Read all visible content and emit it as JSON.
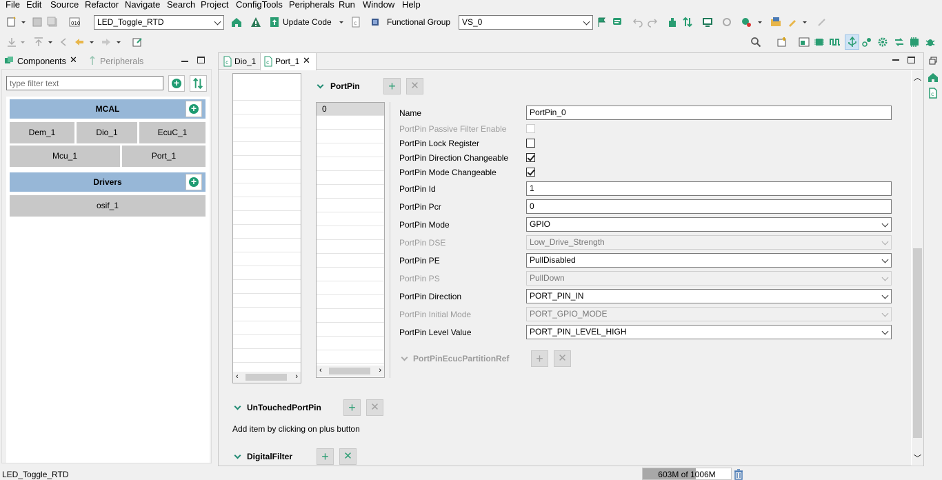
{
  "menu": [
    "File",
    "Edit",
    "Source",
    "Refactor",
    "Navigate",
    "Search",
    "Project",
    "ConfigTools",
    "Peripherals",
    "Run",
    "Window",
    "Help"
  ],
  "toolbar": {
    "project_combo": "LED_Toggle_RTD",
    "update_code_label": "Update Code",
    "functional_group_label": "Functional Group",
    "functional_group_value": "VS_0"
  },
  "left_panel": {
    "tabs": [
      {
        "label": "Components"
      },
      {
        "label": "Peripherals"
      }
    ],
    "filter_placeholder": "type filter text",
    "groups": [
      {
        "title": "MCAL",
        "items": [
          "Dem_1",
          "Dio_1",
          "EcuC_1",
          "Mcu_1",
          "Port_1"
        ]
      },
      {
        "title": "Drivers",
        "items": [
          "osif_1"
        ]
      }
    ]
  },
  "editor": {
    "tabs": [
      {
        "label": "Dio_1"
      },
      {
        "label": "Port_1"
      }
    ],
    "portpin_section": "PortPin",
    "portpin_list": [
      "0"
    ],
    "properties": [
      {
        "label": "Name",
        "type": "text",
        "value": "PortPin_0",
        "enabled": true
      },
      {
        "label": "PortPin Passive Filter Enable",
        "type": "checkbox",
        "checked": false,
        "enabled": false
      },
      {
        "label": "PortPin Lock Register",
        "type": "checkbox",
        "checked": false,
        "enabled": true
      },
      {
        "label": "PortPin Direction Changeable",
        "type": "checkbox",
        "checked": true,
        "enabled": true
      },
      {
        "label": "PortPin Mode Changeable",
        "type": "checkbox",
        "checked": true,
        "enabled": true
      },
      {
        "label": "PortPin Id",
        "type": "text",
        "value": "1",
        "enabled": true
      },
      {
        "label": "PortPin Pcr",
        "type": "text",
        "value": "0",
        "enabled": true
      },
      {
        "label": "PortPin Mode",
        "type": "select",
        "value": "GPIO",
        "enabled": true
      },
      {
        "label": "PortPin DSE",
        "type": "select",
        "value": "Low_Drive_Strength",
        "enabled": false
      },
      {
        "label": "PortPin PE",
        "type": "select",
        "value": "PullDisabled",
        "enabled": true
      },
      {
        "label": "PortPin PS",
        "type": "select",
        "value": "PullDown",
        "enabled": false
      },
      {
        "label": "PortPin Direction",
        "type": "select",
        "value": "PORT_PIN_IN",
        "enabled": true
      },
      {
        "label": "PortPin Initial Mode",
        "type": "select",
        "value": "PORT_GPIO_MODE",
        "enabled": false
      },
      {
        "label": "PortPin Level Value",
        "type": "select",
        "value": "PORT_PIN_LEVEL_HIGH",
        "enabled": true
      }
    ],
    "ecuc_ref_section": "PortPinEcucPartitionRef",
    "untouched_section": "UnTouchedPortPin",
    "untouched_hint": "Add item by clicking on plus button",
    "digital_filter_section": "DigitalFilter"
  },
  "status": {
    "project": "LED_Toggle_RTD",
    "heap": "603M of 1006M",
    "heap_used_fraction": 0.6
  }
}
